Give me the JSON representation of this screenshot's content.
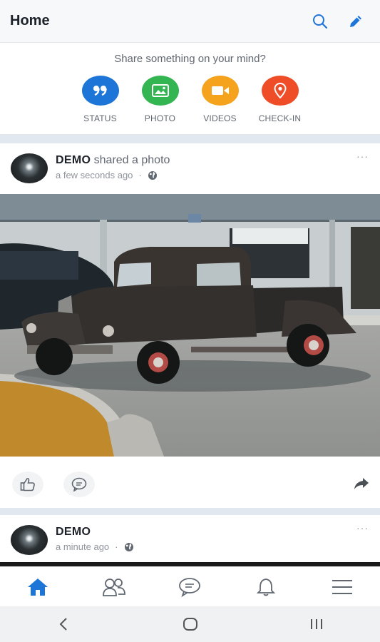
{
  "header": {
    "title": "Home",
    "icons": [
      "search-icon",
      "edit-icon"
    ]
  },
  "composer": {
    "prompt": "Share something on your mind?",
    "actions": [
      {
        "label": "STATUS",
        "icon": "quote-icon",
        "color": "#1e75d8"
      },
      {
        "label": "PHOTO",
        "icon": "photo-icon",
        "color": "#33b552"
      },
      {
        "label": "VIDEOS",
        "icon": "video-icon",
        "color": "#f5a31c"
      },
      {
        "label": "CHECK-IN",
        "icon": "location-pin-icon",
        "color": "#ee4d28"
      }
    ]
  },
  "posts": [
    {
      "author": "DEMO",
      "action": "shared a photo",
      "time": "a few seconds ago",
      "privacy_icon": "globe-icon",
      "menu": "···"
    },
    {
      "author": "DEMO",
      "action": "",
      "time": "a minute ago",
      "privacy_icon": "globe-icon",
      "menu": "···"
    }
  ],
  "post_actions": {
    "icons": [
      "like-icon",
      "comment-icon",
      "share-icon"
    ]
  },
  "bottom_nav": {
    "active": "home",
    "items": [
      "home-icon",
      "friends-icon",
      "messages-icon",
      "notifications-icon",
      "menu-icon"
    ],
    "active_color": "#1e75d8"
  },
  "system_nav": {
    "items": [
      "back-icon",
      "home-circle-icon",
      "recents-icon"
    ]
  }
}
